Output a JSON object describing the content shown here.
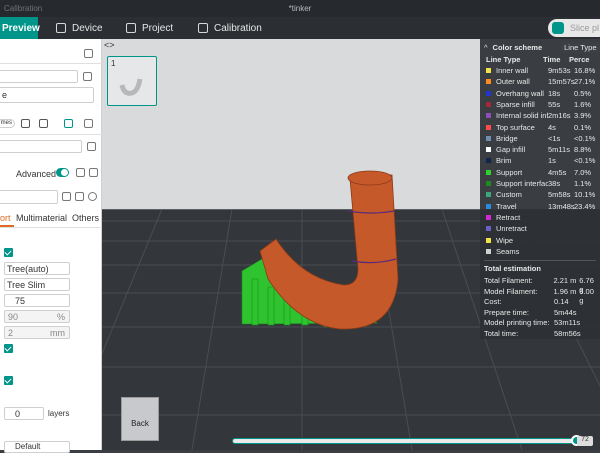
{
  "titlebar": {
    "app": "Calibration",
    "doc": "*tinker"
  },
  "menubar": {
    "preview": "Preview",
    "device": "Device",
    "project": "Project",
    "calibration": "Calibration",
    "slice": "Slice pl"
  },
  "left": {
    "row1_value": "e",
    "chip": "mes",
    "advanced": "Advanced",
    "tabs": [
      "ort",
      "Multimaterial",
      "Others"
    ],
    "type_value": "Tree(auto)",
    "style_value": "Tree Slim",
    "angle_value": "75",
    "pct_value": "90",
    "pct_unit": "%",
    "mm_value": "2",
    "mm_unit": "mm",
    "layers_value": "0",
    "layers_unit": "layers",
    "bottom_select": "Default"
  },
  "viewport": {
    "thumb_number": "1",
    "back_label": "Back",
    "layer_num": "72"
  },
  "legend": {
    "title": "Color scheme",
    "select": "Line Type",
    "columns": [
      "Line Type",
      "Time",
      "Perce"
    ],
    "items": [
      {
        "name": "Inner wall",
        "time": "9m53s",
        "pct": "16.8%",
        "color": "#f2e34a"
      },
      {
        "name": "Outer wall",
        "time": "15m57s",
        "pct": "27.1%",
        "color": "#ff8a1f"
      },
      {
        "name": "Overhang wall",
        "time": "18s",
        "pct": "0.5%",
        "color": "#2334d4"
      },
      {
        "name": "Sparse infill",
        "time": "55s",
        "pct": "1.6%",
        "color": "#a3293a"
      },
      {
        "name": "Internal solid infill",
        "time": "2m16s",
        "pct": "3.9%",
        "color": "#8e4eb7"
      },
      {
        "name": "Top surface",
        "time": "4s",
        "pct": "0.1%",
        "color": "#ff4a4a"
      },
      {
        "name": "Bridge",
        "time": "<1s",
        "pct": "<0.1%",
        "color": "#6f8fb0"
      },
      {
        "name": "Gap infill",
        "time": "5m11s",
        "pct": "8.8%",
        "color": "#ffffff"
      },
      {
        "name": "Brim",
        "time": "1s",
        "pct": "<0.1%",
        "color": "#0e2550"
      },
      {
        "name": "Support",
        "time": "4m5s",
        "pct": "7.0%",
        "color": "#2bd22b"
      },
      {
        "name": "Support interface",
        "time": "38s",
        "pct": "1.1%",
        "color": "#1f8a1f"
      },
      {
        "name": "Custom",
        "time": "5m58s",
        "pct": "10.1%",
        "color": "#3aa67a"
      },
      {
        "name": "Travel",
        "time": "13m48s",
        "pct": "23.4%",
        "color": "#2a8ae0"
      },
      {
        "name": "Retract",
        "time": "",
        "pct": "",
        "color": "#d229d2"
      },
      {
        "name": "Unretract",
        "time": "",
        "pct": "",
        "color": "#6c5fc7"
      },
      {
        "name": "Wipe",
        "time": "",
        "pct": "",
        "color": "#f2e34a"
      },
      {
        "name": "Seams",
        "time": "",
        "pct": "",
        "color": "#d0d0d0"
      }
    ],
    "estimation_title": "Total estimation",
    "estimation": [
      {
        "k": "Total Filament:",
        "v": "2.21 m",
        "v2": "6.76 g"
      },
      {
        "k": "Model Filament:",
        "v": "1.96 m",
        "v2": "6.00 g"
      },
      {
        "k": "Cost:",
        "v": "0.14",
        "v2": ""
      },
      {
        "k": "Prepare time:",
        "v": "5m44s",
        "v2": ""
      },
      {
        "k": "Model printing time:",
        "v": "53m11s",
        "v2": ""
      },
      {
        "k": "Total time:",
        "v": "58m56s",
        "v2": ""
      }
    ]
  },
  "progress": {
    "fraction": 1.0
  }
}
